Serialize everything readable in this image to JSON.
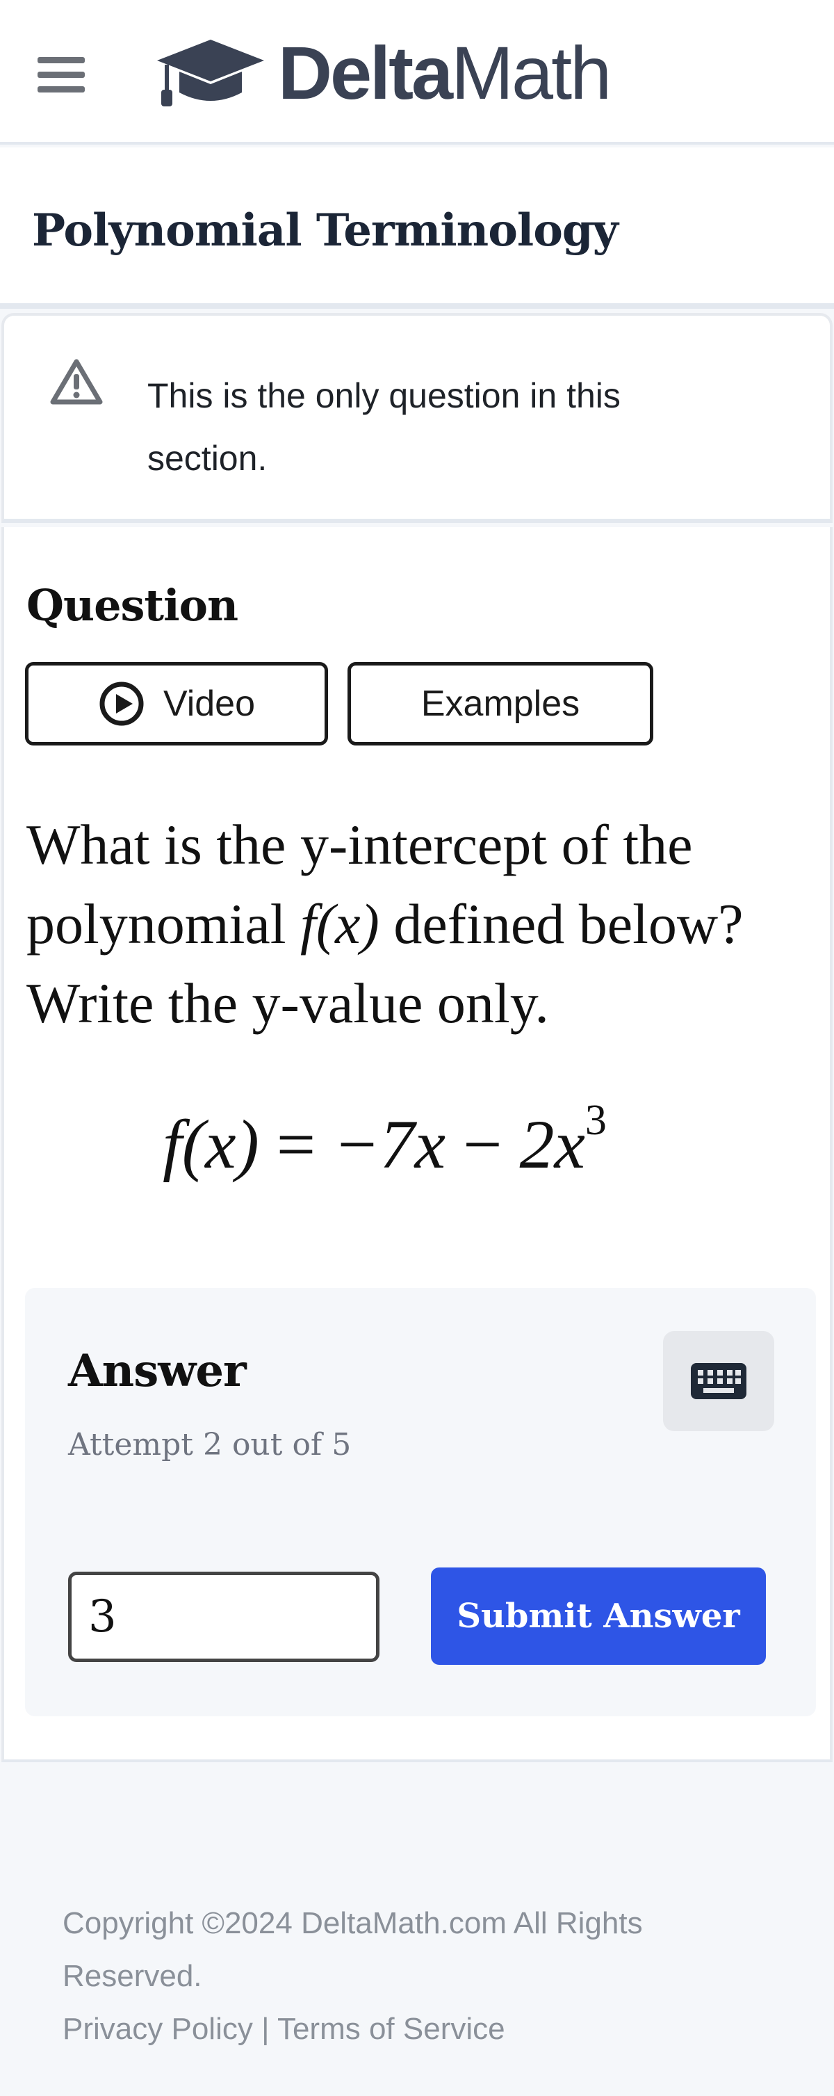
{
  "header": {
    "menu_icon": "hamburger-menu-icon",
    "logo_icon": "graduation-cap-icon",
    "logo_bold": "Delta",
    "logo_light": "Math"
  },
  "page_title": "Polynomial Terminology",
  "notice": {
    "icon": "warning-triangle-icon",
    "text": "This is the only question in this section."
  },
  "question": {
    "heading": "Question",
    "video_label": "Video",
    "video_icon": "play-circle-icon",
    "examples_label": "Examples",
    "prompt_before": "What is the y-intercept of the polynomial ",
    "prompt_math": "f(x)",
    "prompt_after": " defined below? Write the y-value only.",
    "equation": {
      "lhs": "f(x)",
      "eq": "=",
      "term1": "−7x",
      "minus": "−",
      "term2_coef": "2x",
      "term2_exp": "3"
    }
  },
  "answer": {
    "title": "Answer",
    "attempt_text": "Attempt 2 out of 5",
    "keyboard_icon": "keyboard-icon",
    "input_value": "3",
    "submit_label": "Submit Answer"
  },
  "footer": {
    "copyright": "Copyright ©2024 DeltaMath.com All Rights Reserved.",
    "privacy_label": "Privacy Policy",
    "separator": "|",
    "terms_label": "Terms of Service"
  },
  "colors": {
    "accent": "#2e55e6",
    "logo": "#3a4254",
    "background": "#f5f7fa"
  }
}
